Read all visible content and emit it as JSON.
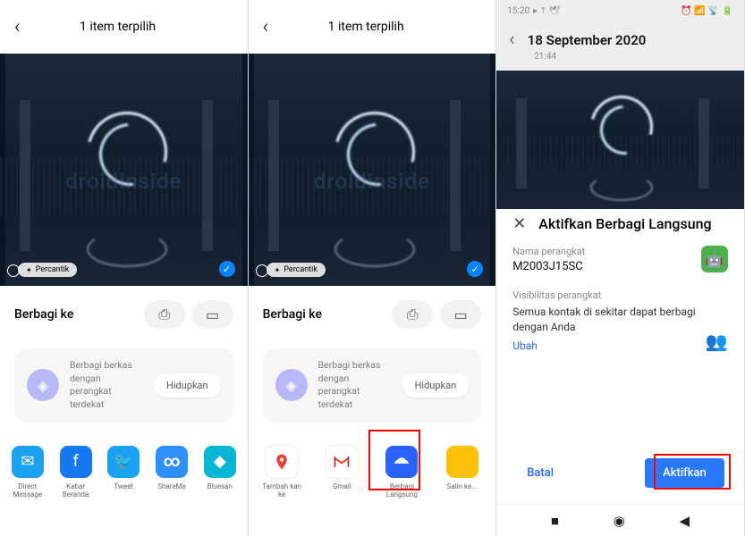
{
  "screen1": {
    "title": "1 item terpilih",
    "percantik": "Percantik",
    "share_label": "Berbagi ke",
    "watermark": "droidinside",
    "hidupkan": {
      "text": "Berbagi berkas dengan perangkat terdekat",
      "button": "Hidupkan"
    },
    "apps": [
      {
        "label": "Direct Message"
      },
      {
        "label": "Kabar Beranda"
      },
      {
        "label": "Tweet"
      },
      {
        "label": "ShareMe"
      },
      {
        "label": "Bluesan"
      }
    ]
  },
  "screen2": {
    "title": "1 item terpilih",
    "percantik": "Percantik",
    "share_label": "Berbagi ke",
    "watermark": "droidinside",
    "hidupkan": {
      "text": "Berbagi berkas dengan perangkat terdekat",
      "button": "Hidupkan"
    },
    "apps": [
      {
        "label": "Tambah kan ke"
      },
      {
        "label": "Gmail"
      },
      {
        "label": "Berbagi Langsung"
      },
      {
        "label": "Salin ke..."
      }
    ]
  },
  "screen3": {
    "status_time": "15:20",
    "header_date": "18 September 2020",
    "header_time": "21:44",
    "sheet_title": "Aktifkan Berbagi Langsung",
    "device_label": "Nama perangkat",
    "device_value": "M2003J15SC",
    "visibility_label": "Visibilitas perangkat",
    "visibility_desc": "Semua kontak di sekitar dapat berbagi dengan Anda",
    "ubah": "Ubah",
    "batal": "Batal",
    "aktifkan": "Aktifkan"
  }
}
